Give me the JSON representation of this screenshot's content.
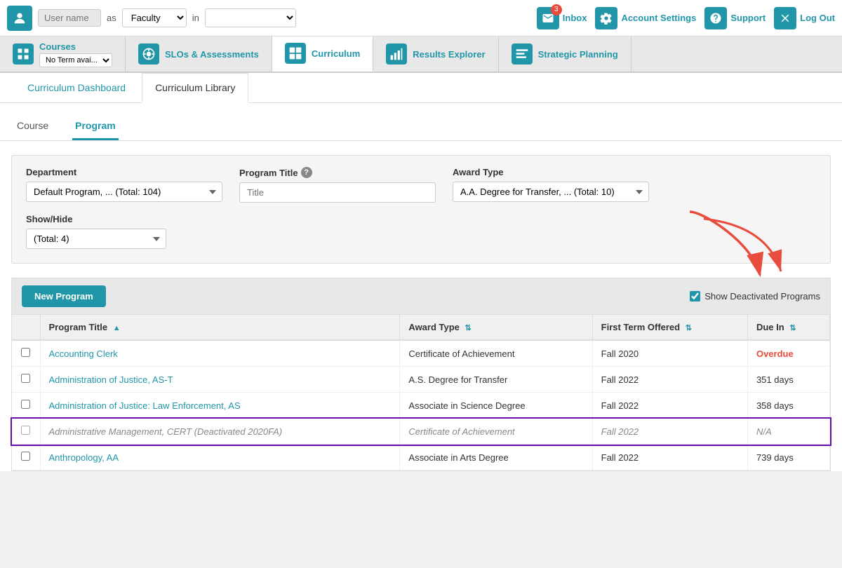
{
  "topbar": {
    "user_placeholder": "Username",
    "as_label": "as",
    "role_value": "Faculty",
    "in_label": "in",
    "campus_placeholder": "",
    "actions": [
      {
        "id": "inbox",
        "icon": "✉",
        "label": "Inbox",
        "badge": "3"
      },
      {
        "id": "account-settings",
        "icon": "⚙",
        "label": "Account Settings",
        "badge": null
      },
      {
        "id": "support",
        "icon": "?",
        "label": "Support",
        "badge": null
      },
      {
        "id": "logout",
        "icon": "✕",
        "label": "Log Out",
        "badge": null
      }
    ]
  },
  "navbar": {
    "items": [
      {
        "id": "courses",
        "icon": "▦",
        "label": "Courses",
        "sub": "No Term avai..."
      },
      {
        "id": "slos",
        "icon": "◎",
        "label": "SLOs & Assessments",
        "sub": null
      },
      {
        "id": "curriculum",
        "icon": "⊞",
        "label": "Curriculum",
        "sub": null
      },
      {
        "id": "results",
        "icon": "📊",
        "label": "Results Explorer",
        "sub": null
      },
      {
        "id": "strategic",
        "icon": "⊟",
        "label": "Strategic Planning",
        "sub": null
      }
    ]
  },
  "breadcrumbs": {
    "tabs": [
      {
        "id": "dashboard",
        "label": "Curriculum Dashboard"
      },
      {
        "id": "library",
        "label": "Curriculum Library"
      }
    ],
    "active": "library"
  },
  "subtabs": {
    "items": [
      {
        "id": "course",
        "label": "Course"
      },
      {
        "id": "program",
        "label": "Program"
      }
    ],
    "active": "program"
  },
  "filters": {
    "department": {
      "label": "Department",
      "value": "Default Program, ... (Total: 104)",
      "help": false
    },
    "program_title": {
      "label": "Program Title",
      "placeholder": "Title",
      "help": true
    },
    "award_type": {
      "label": "Award Type",
      "value": "A.A. Degree for Transfer, ... (Total: 10)"
    },
    "show_hide": {
      "label": "Show/Hide",
      "value": "(Total: 4)"
    }
  },
  "table": {
    "toolbar": {
      "new_program_label": "New Program",
      "show_deactivated_label": "Show Deactivated Programs",
      "show_deactivated_checked": true
    },
    "columns": [
      {
        "id": "checkbox",
        "label": ""
      },
      {
        "id": "program_title",
        "label": "Program Title",
        "sortable": true,
        "sort_dir": "asc"
      },
      {
        "id": "award_type",
        "label": "Award Type",
        "sortable": true,
        "sort_dir": null
      },
      {
        "id": "first_term",
        "label": "First Term Offered",
        "sortable": true,
        "sort_dir": null
      },
      {
        "id": "due_in",
        "label": "Due In",
        "sortable": true,
        "sort_dir": null
      }
    ],
    "rows": [
      {
        "id": 1,
        "program_title": "Accounting Clerk",
        "award_type": "Certificate of Achievement",
        "first_term": "Fall 2020",
        "due_in": "Overdue",
        "due_in_status": "overdue",
        "deactivated": false
      },
      {
        "id": 2,
        "program_title": "Administration of Justice, AS-T",
        "award_type": "A.S. Degree for Transfer",
        "first_term": "Fall 2022",
        "due_in": "351 days",
        "due_in_status": "normal",
        "deactivated": false
      },
      {
        "id": 3,
        "program_title": "Administration of Justice: Law Enforcement, AS",
        "award_type": "Associate in Science Degree",
        "first_term": "Fall 2022",
        "due_in": "358 days",
        "due_in_status": "normal",
        "deactivated": false
      },
      {
        "id": 4,
        "program_title": "Administrative Management, CERT (Deactivated 2020FA)",
        "award_type": "Certificate of Achievement",
        "first_term": "Fall 2022",
        "due_in": "N/A",
        "due_in_status": "na",
        "deactivated": true
      },
      {
        "id": 5,
        "program_title": "Anthropology, AA",
        "award_type": "Associate in Arts Degree",
        "first_term": "Fall 2022",
        "due_in": "739 days",
        "due_in_status": "normal",
        "deactivated": false
      }
    ]
  },
  "colors": {
    "primary": "#2196a8",
    "overdue": "#e74c3c",
    "deactivated_border": "#6a0dab"
  }
}
